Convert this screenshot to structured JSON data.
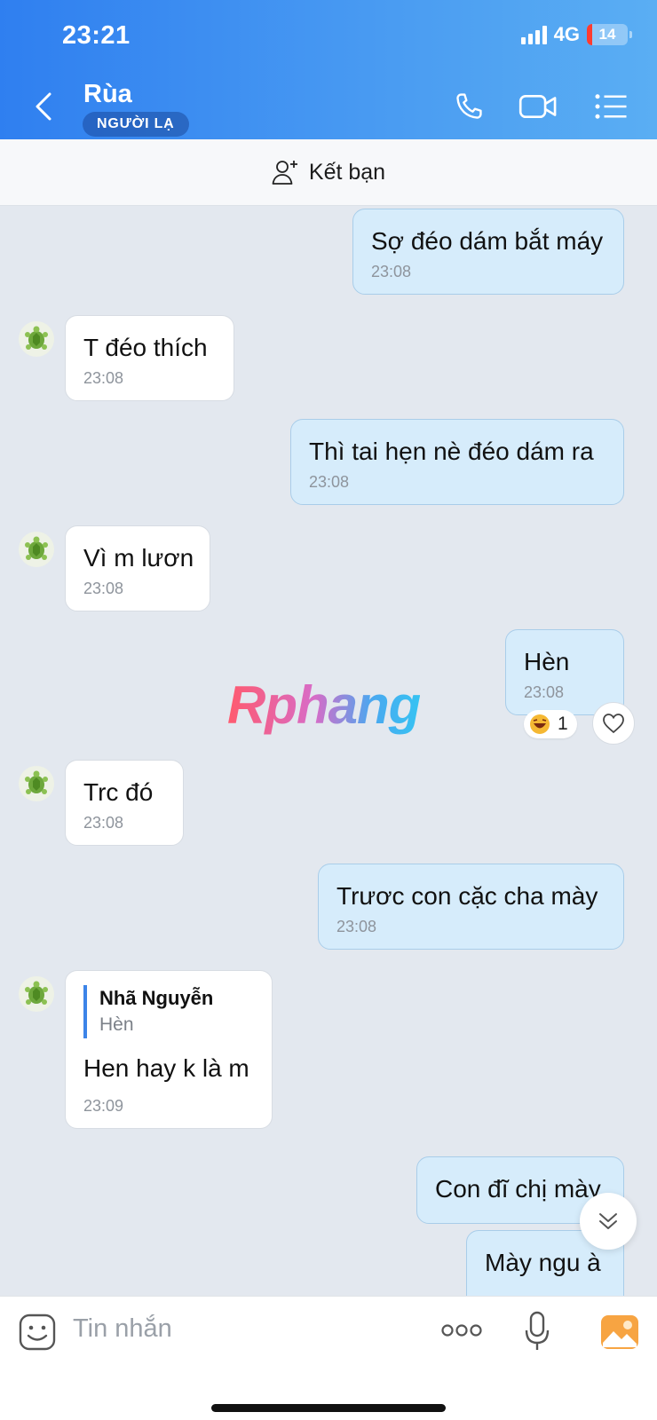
{
  "status_bar": {
    "time": "23:21",
    "network": "4G",
    "battery": "14"
  },
  "header": {
    "title": "Rùa",
    "badge": "NGƯỜI LẠ"
  },
  "friend_bar": {
    "label": "Kết bạn"
  },
  "watermark": "Rphang",
  "messages": [
    {
      "dir": "out",
      "text": "Sợ đéo dám bắt máy",
      "time": "23:08"
    },
    {
      "dir": "in",
      "text": "T đéo thích",
      "time": "23:08"
    },
    {
      "dir": "out",
      "text": "Thì tai hẹn nè đéo dám ra",
      "time": "23:08"
    },
    {
      "dir": "in",
      "text": "Vì m lươn",
      "time": "23:08"
    },
    {
      "dir": "out",
      "text": "Hèn",
      "time": "23:08",
      "reaction_count": "1"
    },
    {
      "dir": "in",
      "text": "Trc đó",
      "time": "23:08"
    },
    {
      "dir": "out",
      "text": "Trươc con cặc cha mày",
      "time": "23:08"
    },
    {
      "dir": "in",
      "text": "Hen hay k là m",
      "time": "23:09",
      "quote": {
        "name": "Nhã Nguyễn",
        "text": "Hèn"
      }
    },
    {
      "dir": "out",
      "text": "Con đĩ chị mày",
      "time": ""
    },
    {
      "dir": "out",
      "text": "Mày ngu à",
      "time": ""
    }
  ],
  "input": {
    "placeholder": "Tin nhắn"
  },
  "icons": [
    "back-icon",
    "phone-icon",
    "video-icon",
    "list-icon",
    "add-friend-icon",
    "turtle-avatar",
    "laugh-emoji-icon",
    "heart-icon",
    "chevron-double-down-icon",
    "sticker-icon",
    "more-icon",
    "mic-icon",
    "image-icon"
  ],
  "colors": {
    "header_start": "#2f7ff0",
    "header_end": "#5aaef3",
    "outgoing_bubble": "#d6ecfb",
    "incoming_bubble": "#ffffff",
    "chat_bg": "#e3e8ef"
  }
}
